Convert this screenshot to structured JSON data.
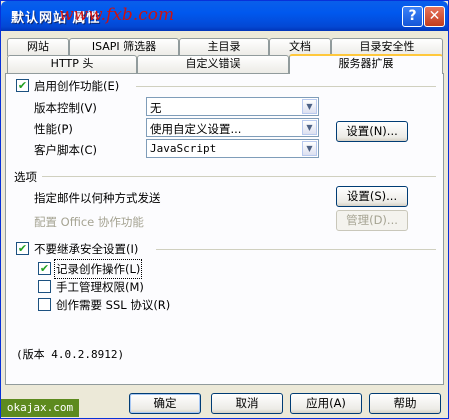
{
  "window": {
    "title": "默认网站 属性",
    "watermark": "www.fxb.com"
  },
  "titlebar": {
    "help_label": "?",
    "close_label": "✕"
  },
  "tabs_row1": [
    "网站",
    "ISAPI 筛选器",
    "主目录",
    "文档",
    "目录安全性"
  ],
  "tabs_row2": [
    "HTTP 头",
    "自定义错误",
    "服务器扩展"
  ],
  "active_tab": "服务器扩展",
  "authoring": {
    "enable_label": "启用创作功能(E)",
    "enabled": true,
    "version_control_label": "版本控制(V)",
    "version_control_value": "无",
    "performance_label": "性能(P)",
    "performance_value": "使用自定义设置...",
    "client_script_label": "客户脚本(C)",
    "client_script_value": "JavaScript",
    "settings_label": "设置(N)..."
  },
  "options": {
    "section_label": "选项",
    "mail_label": "指定邮件以何种方式发送",
    "mail_settings_label": "设置(S)...",
    "office_label": "配置 Office 协作功能",
    "office_manage_label": "管理(D)..."
  },
  "security": {
    "no_inherit_label": "不要继承安全设置(I)",
    "no_inherit": true,
    "log_label": "记录创作操作(L)",
    "log_checked": true,
    "manual_perm_label": "手工管理权限(M)",
    "manual_perm_checked": false,
    "ssl_label": "创作需要 SSL 协议(R)",
    "ssl_checked": false
  },
  "version_text": "(版本 4.0.2.8912)",
  "footer": {
    "ok_label": "确定",
    "cancel_label": "取消",
    "apply_label": "应用(A)",
    "help_label": "帮助",
    "site_label": "okajax.com"
  },
  "check_glyph": "✔"
}
